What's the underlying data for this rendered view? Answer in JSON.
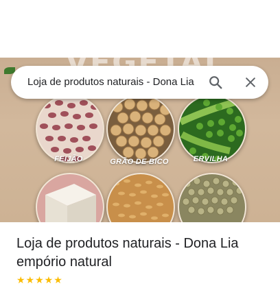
{
  "search": {
    "query": "Loja de produtos naturais - Dona Lia"
  },
  "hero": {
    "banner_text": "VEGETAL",
    "items": [
      {
        "label": "FEIJÃO",
        "icon": "beans-image"
      },
      {
        "label": "GRÃO DE BICO",
        "icon": "chickpeas-image"
      },
      {
        "label": "ERVILHA",
        "icon": "peas-image"
      },
      {
        "label": "",
        "icon": "tofu-image"
      },
      {
        "label": "",
        "icon": "flaxseed-image"
      },
      {
        "label": "",
        "icon": "lentils-image"
      }
    ]
  },
  "place": {
    "name_line1": "Loja de produtos naturais - Dona Lia",
    "name_line2": "empório natural",
    "stars": "★★★★★"
  },
  "colors": {
    "accent_star": "#fbbc04",
    "icon_gray": "#5f6368"
  }
}
